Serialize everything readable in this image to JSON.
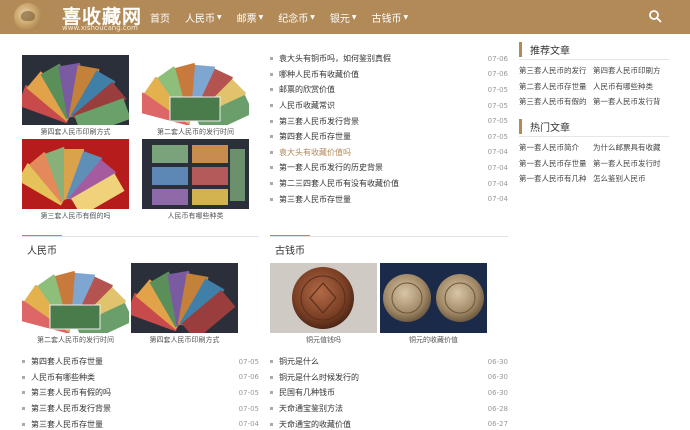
{
  "site": {
    "title": "喜收藏网",
    "subtitle": "www.xishoucang.com"
  },
  "nav": {
    "items": [
      {
        "label": "首页",
        "dropdown": false
      },
      {
        "label": "人民币",
        "dropdown": true
      },
      {
        "label": "邮票",
        "dropdown": true
      },
      {
        "label": "纪念币",
        "dropdown": true
      },
      {
        "label": "银元",
        "dropdown": true
      },
      {
        "label": "古钱币",
        "dropdown": true
      }
    ]
  },
  "featured": {
    "thumbs": [
      {
        "caption": "第四套人民币印刷方式",
        "icon": "banknote-fan-image"
      },
      {
        "caption": "第二套人民币的发行时间",
        "icon": "banknote-fan-image"
      },
      {
        "caption": "第三套人民币有假的吗",
        "icon": "banknote-fan-image"
      },
      {
        "caption": "人民币有哪些种类",
        "icon": "banknote-collection-image"
      }
    ],
    "articles": [
      {
        "title": "袁大头有铜币吗，如何鉴别真假",
        "date": "07-06",
        "highlight": false
      },
      {
        "title": "哪种人民币有收藏价值",
        "date": "07-06",
        "highlight": false
      },
      {
        "title": "邮票的欣赏价值",
        "date": "07-05",
        "highlight": false
      },
      {
        "title": "人民币收藏常识",
        "date": "07-05",
        "highlight": false
      },
      {
        "title": "第三套人民币发行背景",
        "date": "07-05",
        "highlight": false
      },
      {
        "title": "第四套人民币存世量",
        "date": "07-05",
        "highlight": false
      },
      {
        "title": "袁大头有收藏价值吗",
        "date": "07-04",
        "highlight": true
      },
      {
        "title": "第一套人民币发行的历史背景",
        "date": "07-04",
        "highlight": false
      },
      {
        "title": "第二三四套人民币有没有收藏价值",
        "date": "07-04",
        "highlight": false
      },
      {
        "title": "第三套人民币存世量",
        "date": "07-04",
        "highlight": false
      }
    ]
  },
  "sidebar": {
    "recommended": {
      "title": "推荐文章",
      "items": [
        "第三套人民币的发行",
        "第四套人民币印刷方",
        "第二套人民币存世量",
        "人民币有哪些种类",
        "第三套人民币有假的",
        "第一套人民币发行背"
      ]
    },
    "popular": {
      "title": "热门文章",
      "items": [
        "第一套人民币简介",
        "为什么邮票具有收藏",
        "第一套人民币存世量",
        "第一套人民币发行时",
        "第一套人民币有几种",
        "怎么鉴别人民币"
      ]
    }
  },
  "rmb_section": {
    "title": "人民币",
    "thumbs": [
      {
        "caption": "第二套人民币的发行时间",
        "icon": "banknote-fan-image"
      },
      {
        "caption": "第四套人民币印刷方式",
        "icon": "banknote-fan-image"
      }
    ],
    "articles": [
      {
        "title": "第四套人民币存世量",
        "date": "07-05"
      },
      {
        "title": "人民币有哪些种类",
        "date": "07-06"
      },
      {
        "title": "第三套人民币有假的吗",
        "date": "07-05"
      },
      {
        "title": "第三套人民币发行背景",
        "date": "07-05"
      },
      {
        "title": "第三套人民币存世量",
        "date": "07-04"
      }
    ]
  },
  "coin_section": {
    "title": "古钱币",
    "thumbs": [
      {
        "caption": "铜元值钱吗",
        "icon": "copper-coin-image"
      },
      {
        "caption": "铜元的收藏价值",
        "icon": "copper-coin-image"
      }
    ],
    "articles": [
      {
        "title": "铜元是什么",
        "date": "06-30"
      },
      {
        "title": "铜元是什么时候发行的",
        "date": "06-30"
      },
      {
        "title": "民国有几种钱币",
        "date": "06-30"
      },
      {
        "title": "天命通宝鉴别方法",
        "date": "06-28"
      },
      {
        "title": "天命通宝的收藏价值",
        "date": "06-27"
      }
    ]
  },
  "colors": {
    "header": "#b28a58",
    "accent": "#b28a58"
  }
}
